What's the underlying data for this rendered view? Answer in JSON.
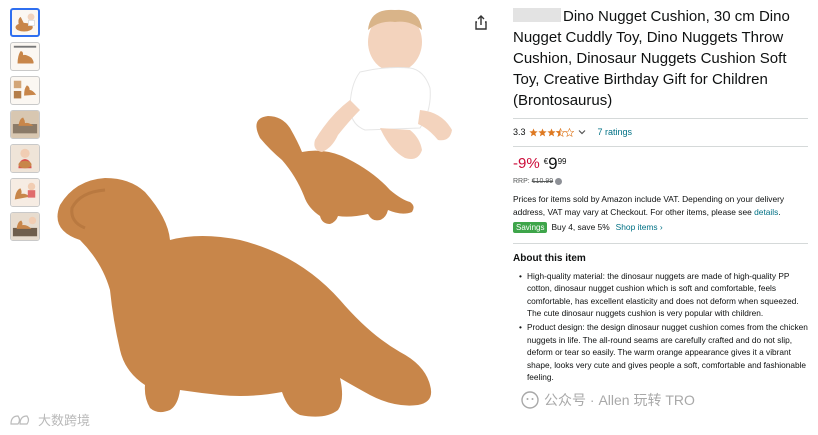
{
  "thumbnails": [
    {
      "name": "thumb-baby-dino",
      "active": true
    },
    {
      "name": "thumb-dimensions"
    },
    {
      "name": "thumb-features"
    },
    {
      "name": "thumb-sofa"
    },
    {
      "name": "thumb-child-hug"
    },
    {
      "name": "thumb-lifestyle"
    },
    {
      "name": "thumb-room"
    }
  ],
  "product": {
    "title_after_redaction": "Dino Nugget Cushion, 30 cm Dino Nugget Cuddly Toy, Dino Nuggets Throw Cushion, Dinosaur Nuggets Cushion Soft Toy, Creative Birthday Gift for Children (Brontosaurus)",
    "rating": "3.3",
    "rating_stars_value": 3.5,
    "ratings_count": "7 ratings",
    "discount": "-9%",
    "currency": "€",
    "price_whole": "9",
    "price_fraction": "99",
    "rrp_label": "RRP:",
    "rrp_value": "€10.99",
    "vat_text": "Prices for items sold by Amazon include VAT. Depending on your delivery address, VAT may vary at Checkout. For other items, please see",
    "vat_link": "details",
    "vat_end": ".",
    "savings_badge": "Savings",
    "savings_text": "Buy 4, save 5%",
    "shop_items_link": "Shop items ›",
    "about_heading": "About this item",
    "bullets": [
      "High-quality material: the dinosaur nuggets are made of high-quality PP cotton, dinosaur nugget cushion which is soft and comfortable, feels comfortable, has excellent elasticity and does not deform when squeezed. The cute dinosaur nuggets cushion is very popular with children.",
      "Product design: the design dinosaur nugget cushion comes from the chicken nuggets in life. The all-round seams are carefully crafted and do not slip, deform or tear so easily. The warm orange appearance gives it a vibrant shape, looks very cute and gives people a soft, comfortable and fashionable feeling."
    ]
  },
  "colors": {
    "accent_link": "#007185",
    "discount_red": "#cc0c39",
    "savings_green": "#3ea54a",
    "star_orange": "#de7921",
    "plush_brown": "#c8864a"
  },
  "watermarks": {
    "left": "大数跨境",
    "right": "公众号 · Allen 玩转 TRO"
  }
}
